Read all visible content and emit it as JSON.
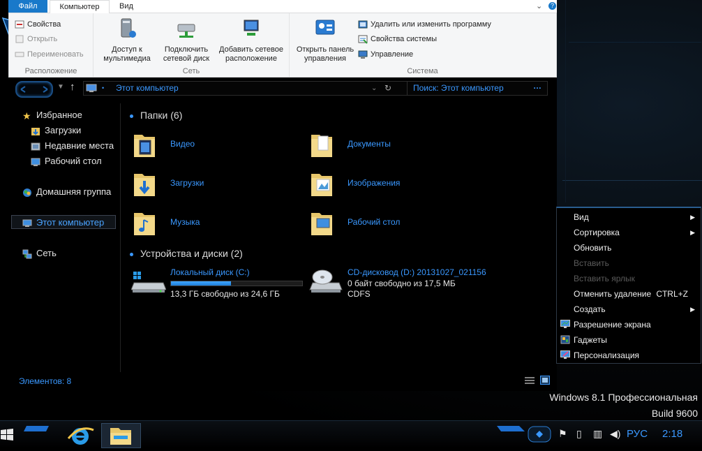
{
  "ribbon_tabs": {
    "file": "Файл",
    "computer": "Компьютер",
    "view": "Вид"
  },
  "window_controls": {
    "expand": "⌄",
    "help": "?"
  },
  "ribbon": {
    "location": {
      "properties": "Свойства",
      "open": "Открыть",
      "rename": "Переименовать",
      "group_label": "Расположение"
    },
    "network": {
      "media_access": "Доступ к мультимедиа",
      "map_drive": "Подключить сетевой диск",
      "add_location": "Добавить сетевое расположение",
      "group_label": "Сеть"
    },
    "system": {
      "control_panel": "Открыть панель управления",
      "uninstall": "Удалить или изменить программу",
      "system_props": "Свойства системы",
      "manage": "Управление",
      "group_label": "Система"
    }
  },
  "address": {
    "path": "Этот компьютер",
    "search_placeholder": "Поиск: Этот компьютер"
  },
  "nav": {
    "favorites": "Избранное",
    "downloads": "Загрузки",
    "recent": "Недавние места",
    "desktop": "Рабочий стол",
    "homegroup": "Домашняя группа",
    "this_pc": "Этот компьютер",
    "network": "Сеть"
  },
  "folders_header": "Папки (6)",
  "folders": [
    "Видео",
    "Документы",
    "Загрузки",
    "Изображения",
    "Музыка",
    "Рабочий стол"
  ],
  "devices_header": "Устройства и диски (2)",
  "drives": {
    "local": {
      "name": "Локальный диск (C:)",
      "free": "13,3 ГБ свободно из 24,6 ГБ",
      "used_fraction": 0.46
    },
    "cd": {
      "name": "CD-дисковод (D:) 20131027_021156",
      "free": "0 байт свободно из 17,5 МБ",
      "fs": "CDFS"
    }
  },
  "status": {
    "items": "Элементов: 8"
  },
  "context_menu": {
    "view": "Вид",
    "sort": "Сортировка",
    "refresh": "Обновить",
    "paste": "Вставить",
    "paste_shortcut": "Вставить ярлык",
    "undo_delete": "Отменить удаление",
    "undo_shortcut": "CTRL+Z",
    "new": "Создать",
    "resolution": "Разрешение экрана",
    "gadgets": "Гаджеты",
    "personalize": "Персонализация"
  },
  "watermark": {
    "line1": "Windows 8.1 Профессиональная",
    "line2": "Build 9600"
  },
  "tray": {
    "lang": "РУС",
    "time": "2:18"
  },
  "colors": {
    "accent": "#3a98ff",
    "ribbon_file_tab": "#1979ca"
  }
}
